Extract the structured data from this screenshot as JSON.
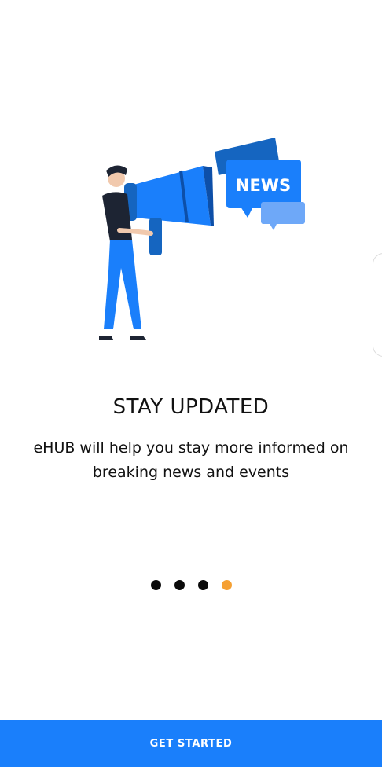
{
  "illustration": {
    "name": "megaphone-news-illustration",
    "badge_text": "NEWS"
  },
  "onboarding": {
    "title": "STAY UPDATED",
    "description": "eHUB will help you stay more informed on breaking news and events"
  },
  "pagination": {
    "total": 4,
    "active_index": 3,
    "colors": {
      "inactive": "#0a0a0a",
      "active": "#f5a033"
    }
  },
  "primary_button": {
    "label": "GET STARTED"
  },
  "colors": {
    "accent": "#1a7ffb"
  }
}
